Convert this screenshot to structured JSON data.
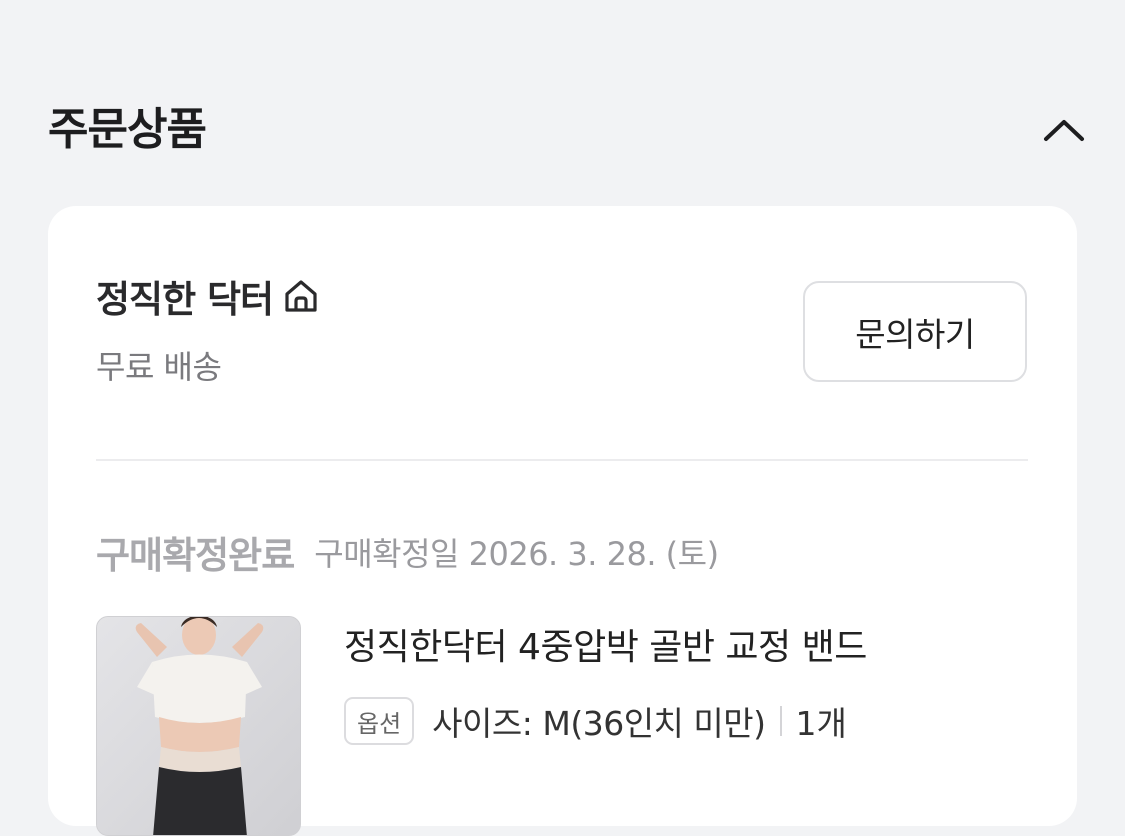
{
  "section": {
    "title": "주문상품",
    "toggle_icon": "chevron-up-icon"
  },
  "seller": {
    "name": "정직한 닥터",
    "icon": "home-icon",
    "shipping": "무료 배송",
    "inquiry_label": "문의하기"
  },
  "order": {
    "status": "구매확정완료",
    "confirm_date": "구매확정일 2026. 3. 28. (토)"
  },
  "product": {
    "name": "정직한닥터 4중압박 골반 교정 밴드",
    "option_badge": "옵션",
    "option": "사이즈: M(36인치 미만)",
    "quantity": "1개"
  },
  "colors": {
    "background": "#f2f3f5",
    "card": "#ffffff",
    "muted_status": "#a9a9ad"
  }
}
